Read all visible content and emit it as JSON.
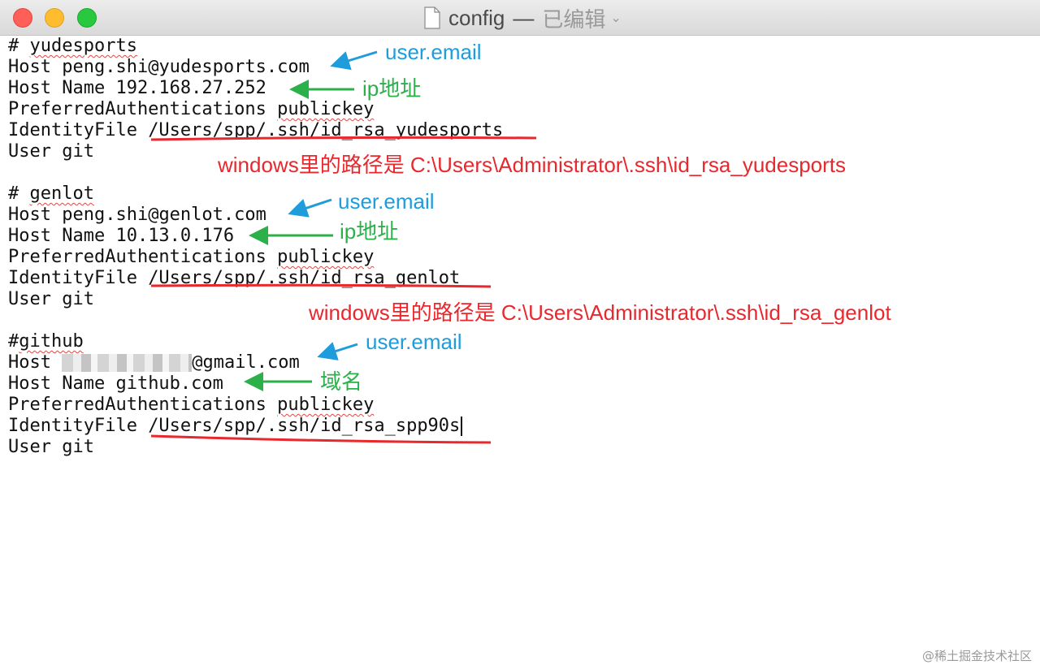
{
  "window": {
    "file_name": "config",
    "separator": "—",
    "state": "已编辑",
    "chevron": "⌄"
  },
  "editor": {
    "blocks": [
      {
        "comment": "# yudesports",
        "host": "peng.shi@yudesports.com",
        "host_name": "192.168.27.252",
        "auth_prefix": "PreferredAuthentications ",
        "auth_value": "publickey",
        "identity_prefix": "IdentityFile ",
        "identity_path": "/Users/spp/.ssh/id_rsa_yudesports",
        "user": "User git"
      },
      {
        "comment": "# genlot",
        "host": "peng.shi@genlot.com",
        "host_name": "10.13.0.176",
        "auth_prefix": "PreferredAuthentications ",
        "auth_value": "publickey",
        "identity_prefix": "IdentityFile ",
        "identity_path": "/Users/spp/.ssh/id_rsa_genlot",
        "user": "User git"
      },
      {
        "comment": "#github",
        "host_suffix": "@gmail.com",
        "host_name": "github.com",
        "auth_prefix": "PreferredAuthentications ",
        "auth_value": "publickey",
        "identity_prefix": "IdentityFile ",
        "identity_path": "/Users/spp/.ssh/id_rsa_spp90s",
        "user": "User git"
      }
    ],
    "host_keyword": "Host ",
    "host_name_keyword": "Host Name "
  },
  "annotations": {
    "email_label": "user.email",
    "ip_label": "ip地址",
    "domain_label": "域名",
    "windows_path_1": "windows里的路径是 C:\\Users\\Administrator\\.ssh\\id_rsa_yudesports",
    "windows_path_2": "windows里的路径是 C:\\Users\\Administrator\\.ssh\\id_rsa_genlot"
  },
  "watermark": "@稀土掘金技术社区",
  "colors": {
    "email_blue": "#1e9cdc",
    "ip_green": "#2bb04a",
    "path_red": "#e8282d"
  }
}
